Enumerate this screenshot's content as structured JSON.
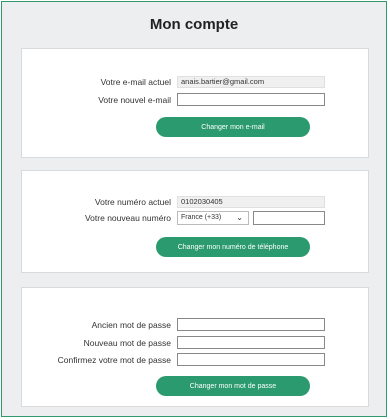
{
  "page_title": "Mon compte",
  "email_section": {
    "current_label": "Votre e-mail actuel",
    "current_value": "anais.bartier@gmail.com",
    "new_label": "Votre nouvel e-mail",
    "new_value": "",
    "button_label": "Changer mon e-mail"
  },
  "phone_section": {
    "current_label": "Votre numéro actuel",
    "current_value": "0102030405",
    "new_label": "Votre nouveau numéro",
    "country_selected": "France (+33)",
    "new_value": "",
    "button_label": "Changer mon numéro de téléphone"
  },
  "password_section": {
    "old_label": "Ancien mot de passe",
    "new_label": "Nouveau mot de passe",
    "confirm_label": "Confirmez votre mot de passe",
    "button_label": "Changer mon mot de passe"
  },
  "colors": {
    "accent": "#2b9a6e",
    "frame_border": "#2f9a6a",
    "background": "#edeef0"
  }
}
